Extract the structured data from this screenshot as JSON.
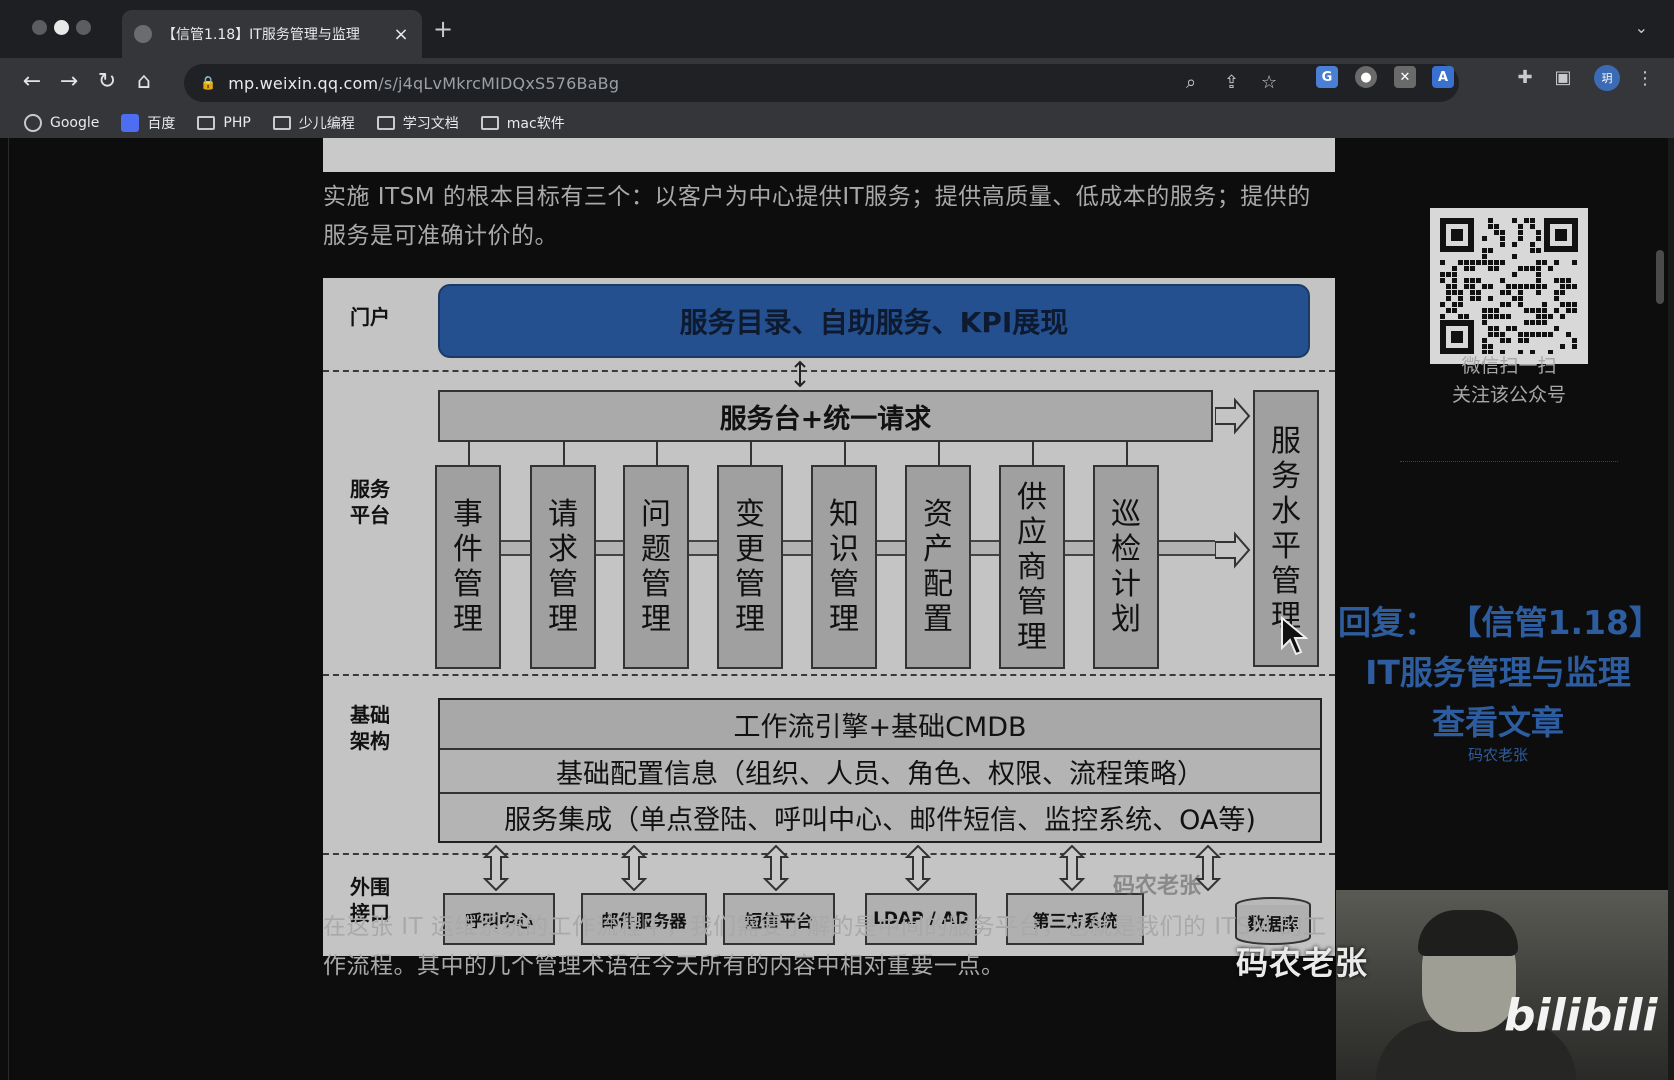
{
  "browser": {
    "tab_title": "【信管1.18】IT服务管理与监理",
    "new_tab": "+",
    "close": "×",
    "url_host": "mp.weixin.qq.com",
    "url_path": "/s/j4qLvMkrcMIDQxS576BaBg",
    "profile_initial": "玥"
  },
  "bookmarks": [
    {
      "label": "Google",
      "icon": "google-icon"
    },
    {
      "label": "百度",
      "icon": "baidu-icon"
    },
    {
      "label": "PHP",
      "icon": "folder-icon"
    },
    {
      "label": "少儿编程",
      "icon": "folder-icon"
    },
    {
      "label": "学习文档",
      "icon": "folder-icon"
    },
    {
      "label": "mac软件",
      "icon": "folder-icon"
    }
  ],
  "article": {
    "para1": "实施 ITSM 的根本目标有三个：以客户为中心提供IT服务；提供高质量、低成本的服务；提供的服务是可准确计价的。",
    "para2": "在这张 IT 运维系统的工作流程中，我们需要了解的是中间的服务平台，也就是我们的 ITSM 的工作流程。其中的几个管理术语在今天所有的内容中相对重要一点。"
  },
  "diagram": {
    "zones": {
      "portal": "门户",
      "service_platform": "服务平台",
      "infrastructure": "基础架构",
      "interfaces": "外围接口"
    },
    "portal_bar": "服务目录、自助服务、KPI展现",
    "service_desk": "服务台+统一请求",
    "processes": [
      "事件管理",
      "请求管理",
      "问题管理",
      "变更管理",
      "知识管理",
      "资产配置",
      "供应商管理",
      "巡检计划"
    ],
    "sla": "服务水平管理",
    "infra_rows": [
      "工作流引擎+基础CMDB",
      "基础配置信息（组织、人员、角色、权限、流程策略）",
      "服务集成（单点登陆、呼叫中心、邮件短信、监控系统、OA等)"
    ],
    "interfaces": [
      "呼叫中心",
      "邮件服务器",
      "短信平台",
      "LDAP / AD",
      "第三方系统",
      "数据库"
    ],
    "watermark": "码农老张"
  },
  "sidebar": {
    "qr_caption_line1": "微信扫一扫",
    "qr_caption_line2": "关注该公众号",
    "promo_line1": "回复：  【信管1.18】",
    "promo_line2": "IT服务管理与监理",
    "promo_line3": "查看文章",
    "promo_sub": "码农老张"
  },
  "overlay": {
    "streamer_name": "码农老张",
    "platform": "bilibili"
  },
  "colors": {
    "portal_blue": "#24508f",
    "promo_blue": "#2e5d9f",
    "diagram_bg": "#c4c4c4"
  }
}
